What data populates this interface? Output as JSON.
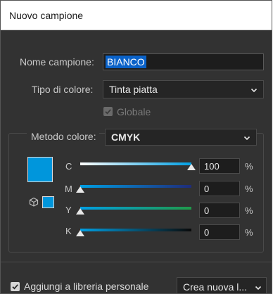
{
  "dialog": {
    "title": "Nuovo campione"
  },
  "form": {
    "name_label": "Nome campione:",
    "name_value": "BIANCO",
    "color_type_label": "Tipo di colore:",
    "color_type_value": "Tinta piatta",
    "global_label": "Globale",
    "global_checked": true,
    "color_mode_label": "Metodo colore:",
    "color_mode_value": "CMYK"
  },
  "swatch": {
    "color": "#0096dc"
  },
  "channels": [
    {
      "letter": "C",
      "value": "100",
      "unit": "%",
      "level": 1.0
    },
    {
      "letter": "M",
      "value": "0",
      "unit": "%",
      "level": 0.0
    },
    {
      "letter": "Y",
      "value": "0",
      "unit": "%",
      "level": 0.0
    },
    {
      "letter": "K",
      "value": "0",
      "unit": "%",
      "level": 0.0
    }
  ],
  "footer": {
    "add_library_label": "Aggiungi a libreria personale",
    "add_library_checked": true,
    "library_select_value": "Crea nuova l..."
  },
  "icons": {
    "dropdown": "chevron-down-icon",
    "checkbox": "checkmark-icon",
    "gamut": "cube-icon"
  }
}
